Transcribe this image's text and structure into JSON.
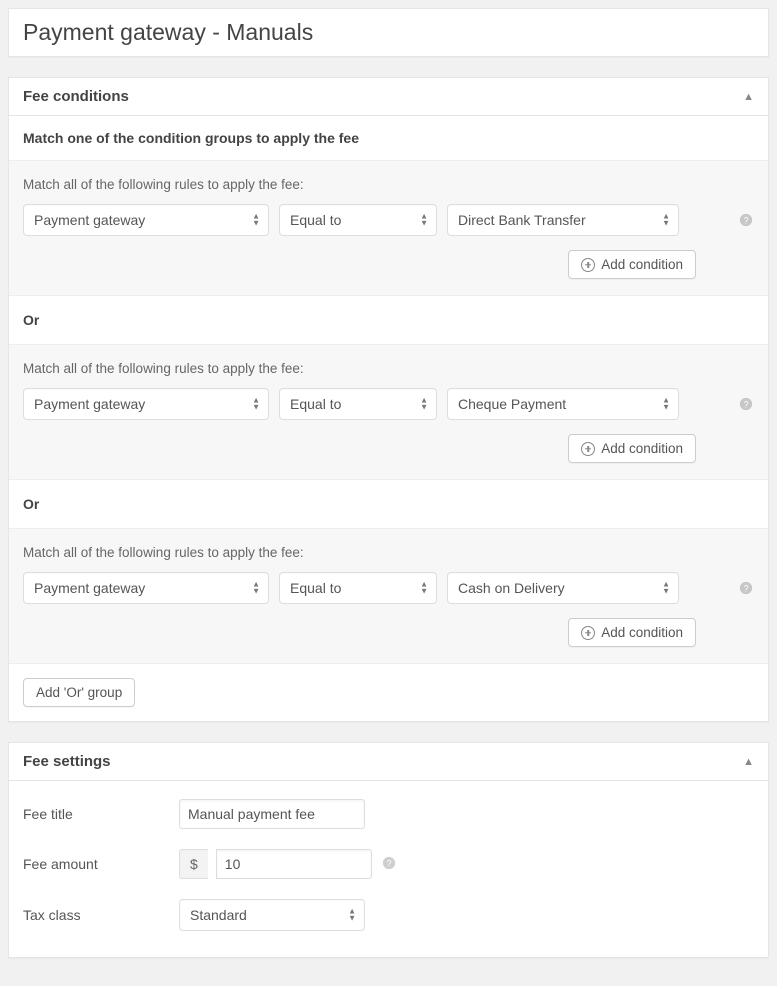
{
  "page_title": "Payment gateway - Manuals",
  "fee_conditions": {
    "header": "Fee conditions",
    "subheader": "Match one of the condition groups to apply the fee",
    "group_instruction": "Match all of the following rules to apply the fee:",
    "or_label": "Or",
    "add_condition_label": "Add condition",
    "add_or_group_label": "Add 'Or' group",
    "groups": [
      {
        "field": "Payment gateway",
        "operator": "Equal to",
        "value": "Direct Bank Transfer"
      },
      {
        "field": "Payment gateway",
        "operator": "Equal to",
        "value": "Cheque Payment"
      },
      {
        "field": "Payment gateway",
        "operator": "Equal to",
        "value": "Cash on Delivery"
      }
    ]
  },
  "fee_settings": {
    "header": "Fee settings",
    "fields": {
      "fee_title": {
        "label": "Fee title",
        "value": "Manual payment fee"
      },
      "fee_amount": {
        "label": "Fee amount",
        "currency": "$",
        "value": "10"
      },
      "tax_class": {
        "label": "Tax class",
        "value": "Standard"
      }
    }
  }
}
